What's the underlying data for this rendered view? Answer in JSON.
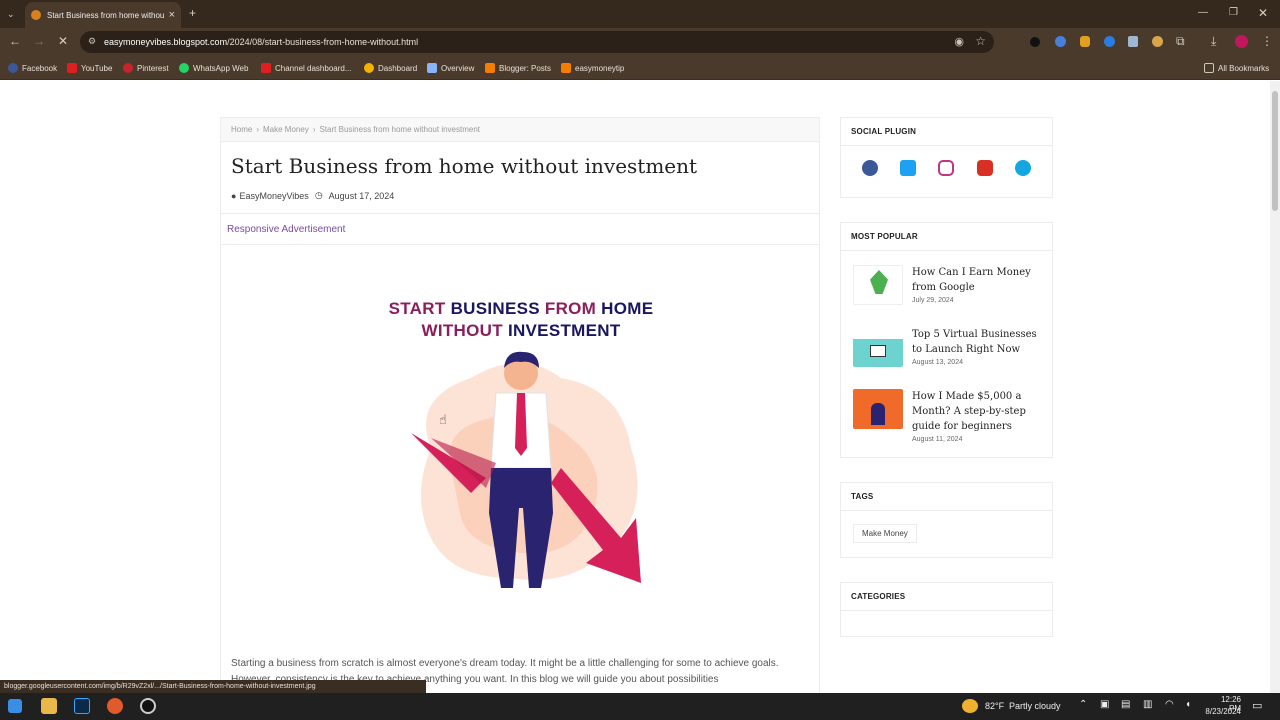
{
  "browser": {
    "tab_title": "Start Business from home withou",
    "url_host": "easymoneyvibes.blogspot.com",
    "url_path": "/2024/08/start-business-from-home-without.html",
    "bookmarks": [
      "Facebook",
      "YouTube",
      "Pinterest",
      "WhatsApp Web",
      "Channel dashboard...",
      "Dashboard",
      "Overview",
      "Blogger: Posts",
      "easymoneytip"
    ],
    "all_bookmarks": "All Bookmarks",
    "status_url": "blogger.googleusercontent.com/img/b/R29vZ2xl/.../Start-Business-from-home-without-investment.jpg"
  },
  "article": {
    "breadcrumb": [
      "Home",
      "›",
      "Make Money",
      "›",
      "Start Business from home without investment"
    ],
    "title": "Start Business from home without investment",
    "author": "EasyMoneyVibes",
    "date": "August 17, 2024",
    "ad_label": "Responsive Advertisement",
    "image_heading_line1a": "START ",
    "image_heading_line1b": "BUSINESS",
    "image_heading_line1c": " FROM ",
    "image_heading_line1d": "HOME",
    "image_heading_line2a": "WITHOUT ",
    "image_heading_line2b": "INVESTMENT",
    "body_text": "Starting a business from scratch is almost everyone's dream today. It might be a little challenging for some to achieve goals. However, consistency is the key to achieve anything you want. In this blog we will guide you about possibilities"
  },
  "sidebar": {
    "social_title": "SOCIAL PLUGIN",
    "social_colors": [
      "#3b5998",
      "#1da1f2",
      "#c13584",
      "#d93025",
      "#12a7e0"
    ],
    "popular_title": "MOST POPULAR",
    "popular": [
      {
        "title": "How Can I Earn Money from Google",
        "date": "July 29, 2024"
      },
      {
        "title": "Top 5 Virtual Businesses to Launch Right Now",
        "date": "August 13, 2024"
      },
      {
        "title": "How I Made $5,000 a Month? A step-by-step guide for beginners",
        "date": "August 11, 2024"
      }
    ],
    "tags_title": "TAGS",
    "tag": "Make Money",
    "categories_title": "CATEGORIES"
  },
  "taskbar": {
    "weather_temp": "82°F",
    "weather_text": "Partly cloudy",
    "time": "12:26 PM",
    "date": "8/23/2024"
  }
}
